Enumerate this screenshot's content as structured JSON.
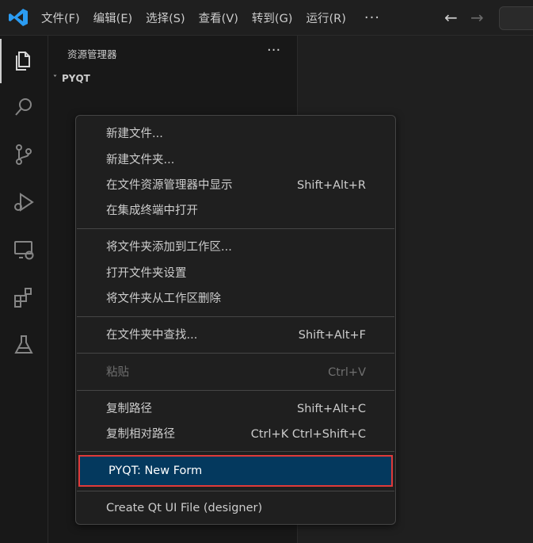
{
  "titlebar": {
    "menus": [
      "文件(F)",
      "编辑(E)",
      "选择(S)",
      "查看(V)",
      "转到(G)",
      "运行(R)"
    ],
    "more": "···",
    "back": "←",
    "forward": "→"
  },
  "activity_icons": [
    "explorer-icon",
    "search-icon",
    "source-control-icon",
    "run-debug-icon",
    "remote-explorer-icon",
    "extensions-icon",
    "testing-icon"
  ],
  "sidebar": {
    "title": "资源管理器",
    "more": "···",
    "folder": "PYQT",
    "chevron": "˅"
  },
  "context_menu": {
    "group1": [
      {
        "label": "新建文件...",
        "shortcut": ""
      },
      {
        "label": "新建文件夹...",
        "shortcut": ""
      },
      {
        "label": "在文件资源管理器中显示",
        "shortcut": "Shift+Alt+R"
      },
      {
        "label": "在集成终端中打开",
        "shortcut": ""
      }
    ],
    "group2": [
      {
        "label": "将文件夹添加到工作区...",
        "shortcut": ""
      },
      {
        "label": "打开文件夹设置",
        "shortcut": ""
      },
      {
        "label": "将文件夹从工作区删除",
        "shortcut": ""
      }
    ],
    "group3": [
      {
        "label": "在文件夹中查找...",
        "shortcut": "Shift+Alt+F"
      }
    ],
    "group4": [
      {
        "label": "粘贴",
        "shortcut": "Ctrl+V",
        "disabled": true
      }
    ],
    "group5": [
      {
        "label": "复制路径",
        "shortcut": "Shift+Alt+C"
      },
      {
        "label": "复制相对路径",
        "shortcut": "Ctrl+K Ctrl+Shift+C"
      }
    ],
    "group6": [
      {
        "label": "PYQT: New Form",
        "shortcut": "",
        "highlighted": true
      }
    ],
    "group7": [
      {
        "label": "Create Qt UI File (designer)",
        "shortcut": ""
      }
    ]
  },
  "colors": {
    "accent_blue": "#04395e",
    "highlight_border": "#e03a3a",
    "vscode_logo": "#2b9cf2"
  }
}
